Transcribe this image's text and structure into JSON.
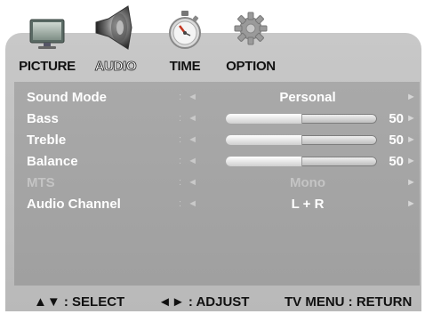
{
  "tabs": [
    {
      "label": "PICTURE",
      "icon": "monitor-icon",
      "active": false
    },
    {
      "label": "AUDIO",
      "icon": "speaker-icon",
      "active": true
    },
    {
      "label": "TIME",
      "icon": "stopwatch-icon",
      "active": false
    },
    {
      "label": "OPTION",
      "icon": "gear-icon",
      "active": false
    }
  ],
  "settings": [
    {
      "name": "Sound Mode",
      "value": "Personal",
      "disabled": false
    },
    {
      "name": "Bass",
      "value": "50",
      "level": 0.5,
      "disabled": false
    },
    {
      "name": "Treble",
      "value": "50",
      "level": 0.5,
      "disabled": false
    },
    {
      "name": "Balance",
      "value": "50",
      "level": 0.5,
      "disabled": false
    },
    {
      "name": "MTS",
      "value": "Mono",
      "disabled": true
    },
    {
      "name": "Audio Channel",
      "value": "L + R",
      "disabled": false
    }
  ],
  "arrows": {
    "left": ": ◄",
    "right": "►"
  },
  "footer": {
    "select": "▲▼ : SELECT",
    "adjust": "◄► : ADJUST",
    "return": "TV MENU : RETURN"
  }
}
